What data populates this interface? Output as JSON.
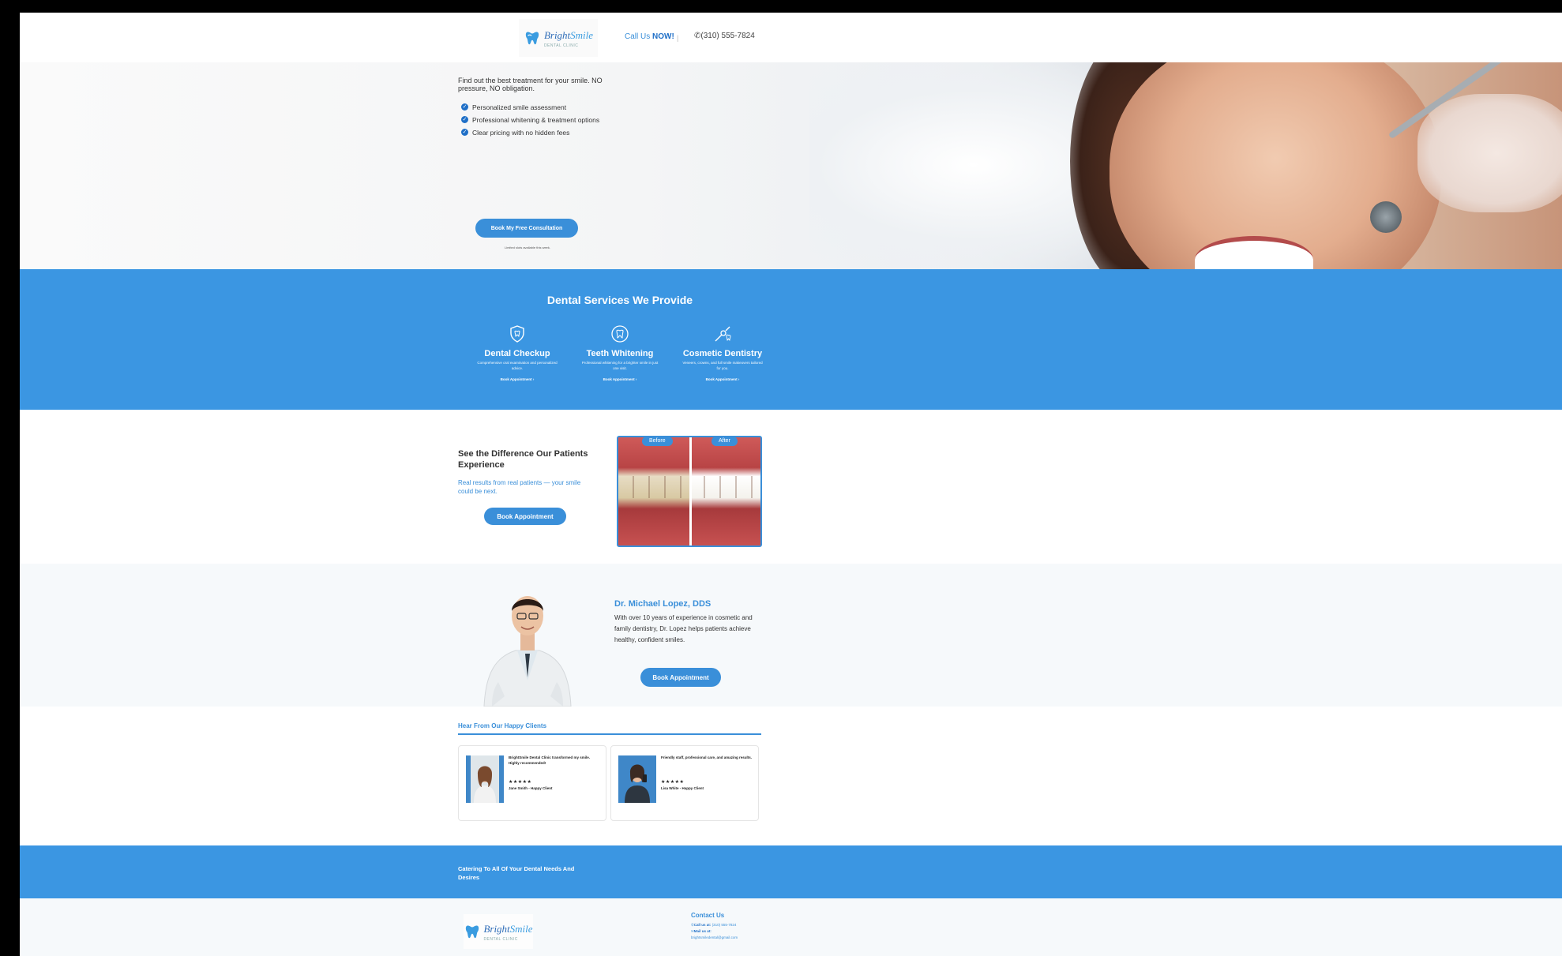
{
  "header": {
    "logo_brand": "Bright",
    "logo_brand_accent": "Smile",
    "logo_sub": "DENTAL CLINIC",
    "call_label": "Call Us",
    "call_emphasis": "NOW!",
    "divider": "|",
    "phone": "(310) 555-7824"
  },
  "hero": {
    "lead": "Find out the best treatment for your smile. NO pressure, NO obligation.",
    "bullets": [
      "Personalized smile assessment",
      "Professional whitening & treatment options",
      "Clear pricing with no hidden fees"
    ],
    "cta": "Book My Free Consultation",
    "note": "Limited slots available this week."
  },
  "services": {
    "title": "Dental Services We Provide",
    "items": [
      {
        "name": "Dental Checkup",
        "desc": "Comprehensive oral examination and personalized advice.",
        "link": "Book Appointment ›"
      },
      {
        "name": "Teeth Whitening",
        "desc": "Professional whitening for a brighter smile in just one visit.",
        "link": "Book Appointment ›"
      },
      {
        "name": "Cosmetic Dentistry",
        "desc": "Veneers, crowns, and full smile makeovers tailored for you.",
        "link": "Book Appointment ›"
      }
    ]
  },
  "before_after": {
    "title": "See the Difference Our Patients Experience",
    "subtitle": "Real results from real patients — your smile could be next.",
    "button": "Book Appointment",
    "tag_before": "Before",
    "tag_after": "After"
  },
  "doctor": {
    "name": "Dr. Michael Lopez, DDS",
    "bio": "With over 10 years of experience in cosmetic and family dentistry, Dr. Lopez helps patients achieve healthy, confident smiles.",
    "button": "Book Appointment"
  },
  "testimonials": {
    "title": "Hear From Our Happy Clients",
    "items": [
      {
        "quote": "BrightSmile Dental Clinic transformed my smile. Highly recommended!",
        "stars": "★★★★★",
        "author": "Jane Smith - Happy Client"
      },
      {
        "quote": "Friendly staff, professional care, and amazing results.",
        "stars": "★★★★★",
        "author": "Lisa White - Happy Client"
      }
    ]
  },
  "band": {
    "text": "Catering To All Of Your Dental Needs And Desires"
  },
  "footer": {
    "contact_title": "Contact Us",
    "call_label": "Call us at:",
    "call_value": "(310) 555-7824",
    "mail_label": "Mail us at:",
    "email": "brightsmiledental@gmail.com"
  },
  "colors": {
    "accent": "#3b96e2",
    "accent_dark": "#1f6fc7"
  }
}
